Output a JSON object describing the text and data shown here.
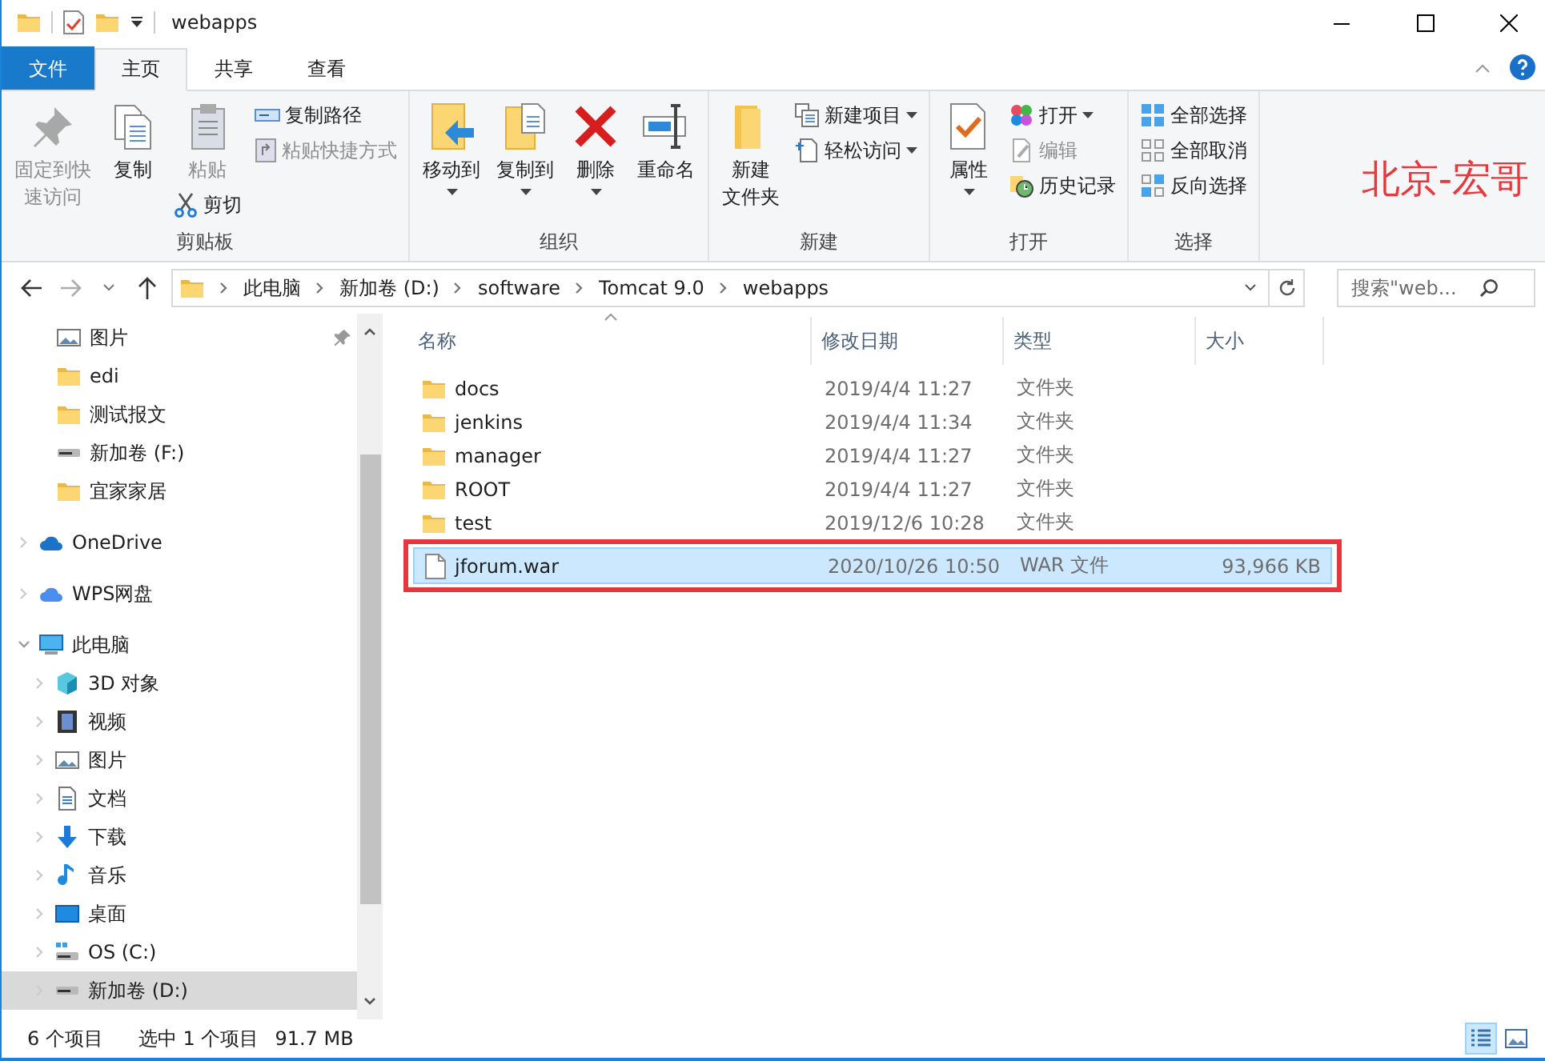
{
  "window": {
    "title": "webapps"
  },
  "tabs": [
    {
      "label": "文件",
      "kind": "file",
      "selected": false
    },
    {
      "label": "主页",
      "kind": "tab",
      "selected": true
    },
    {
      "label": "共享",
      "kind": "tab",
      "selected": false
    },
    {
      "label": "查看",
      "kind": "tab",
      "selected": false
    }
  ],
  "ribbon": {
    "groups": [
      {
        "label": "剪贴板",
        "columns": [
          [
            {
              "kind": "large",
              "lines": [
                "固定到快",
                "速访问"
              ],
              "disabled": true,
              "dropdown": false
            }
          ],
          [
            {
              "kind": "large",
              "lines": [
                "复制"
              ],
              "disabled": false,
              "dropdown": false
            }
          ],
          [
            {
              "kind": "large",
              "lines": [
                "粘贴"
              ],
              "disabled": true,
              "dropdown": false
            },
            {
              "kind": "small",
              "lines": [
                "剪切"
              ],
              "disabled": false,
              "dropdown": false
            }
          ],
          [
            {
              "kind": "small",
              "lines": [
                "复制路径"
              ],
              "disabled": false,
              "dropdown": false
            },
            {
              "kind": "small",
              "lines": [
                "粘贴快捷方式"
              ],
              "disabled": true,
              "dropdown": false
            }
          ]
        ]
      },
      {
        "label": "组织",
        "columns": [
          [
            {
              "kind": "large",
              "lines": [
                "移动到"
              ],
              "disabled": false,
              "dropdown": true
            }
          ],
          [
            {
              "kind": "large",
              "lines": [
                "复制到"
              ],
              "disabled": false,
              "dropdown": true
            }
          ],
          [
            {
              "kind": "large",
              "lines": [
                "删除"
              ],
              "disabled": false,
              "dropdown": true
            }
          ],
          [
            {
              "kind": "large",
              "lines": [
                "重命名"
              ],
              "disabled": false,
              "dropdown": false
            }
          ]
        ]
      },
      {
        "label": "新建",
        "columns": [
          [
            {
              "kind": "large",
              "lines": [
                "新建",
                "文件夹"
              ],
              "disabled": false,
              "dropdown": false
            }
          ],
          [
            {
              "kind": "small",
              "lines": [
                "新建项目"
              ],
              "disabled": false,
              "dropdown": true
            },
            {
              "kind": "small",
              "lines": [
                "轻松访问"
              ],
              "disabled": false,
              "dropdown": true
            }
          ]
        ]
      },
      {
        "label": "打开",
        "columns": [
          [
            {
              "kind": "large",
              "lines": [
                "属性"
              ],
              "disabled": false,
              "dropdown": true
            }
          ],
          [
            {
              "kind": "small",
              "lines": [
                "打开"
              ],
              "disabled": false,
              "dropdown": true
            },
            {
              "kind": "small",
              "lines": [
                "编辑"
              ],
              "disabled": true,
              "dropdown": false
            },
            {
              "kind": "small",
              "lines": [
                "历史记录"
              ],
              "disabled": false,
              "dropdown": false
            }
          ]
        ]
      },
      {
        "label": "选择",
        "columns": [
          [
            {
              "kind": "small",
              "lines": [
                "全部选择"
              ],
              "disabled": false,
              "dropdown": false
            },
            {
              "kind": "small",
              "lines": [
                "全部取消"
              ],
              "disabled": false,
              "dropdown": false
            },
            {
              "kind": "small",
              "lines": [
                "反向选择"
              ],
              "disabled": false,
              "dropdown": false
            }
          ]
        ]
      }
    ],
    "annotation": "北京-宏哥"
  },
  "address": {
    "crumbs": [
      "此电脑",
      "新加卷 (D:)",
      "software",
      "Tomcat 9.0",
      "webapps"
    ]
  },
  "search": {
    "placeholder": "搜索\"web..."
  },
  "nav": {
    "quick_access": [
      {
        "label": "图片",
        "kind": "pictures",
        "pinned": true
      },
      {
        "label": "edi",
        "kind": "folder",
        "pinned": false
      },
      {
        "label": "测试报文",
        "kind": "folder",
        "pinned": false
      },
      {
        "label": "新加卷 (F:)",
        "kind": "drive",
        "pinned": false
      },
      {
        "label": "宜家家居",
        "kind": "folder",
        "pinned": false
      }
    ],
    "roots": [
      {
        "label": "OneDrive",
        "kind": "cloud",
        "expanded": false
      },
      {
        "label": "WPS网盘",
        "kind": "wps",
        "expanded": false
      },
      {
        "label": "此电脑",
        "kind": "pc",
        "expanded": true,
        "children": [
          {
            "label": "3D 对象",
            "kind": "cube",
            "selected": false
          },
          {
            "label": "视频",
            "kind": "video",
            "selected": false
          },
          {
            "label": "图片",
            "kind": "pictures",
            "selected": false
          },
          {
            "label": "文档",
            "kind": "docs",
            "selected": false
          },
          {
            "label": "下载",
            "kind": "download",
            "selected": false
          },
          {
            "label": "音乐",
            "kind": "music",
            "selected": false
          },
          {
            "label": "桌面",
            "kind": "desktop",
            "selected": false
          },
          {
            "label": "OS (C:)",
            "kind": "osdrive",
            "selected": false
          },
          {
            "label": "新加卷 (D:)",
            "kind": "drive",
            "selected": true
          }
        ]
      }
    ]
  },
  "table": {
    "columns": [
      "名称",
      "修改日期",
      "类型",
      "大小"
    ],
    "rows": [
      {
        "name": "docs",
        "kind": "folder",
        "date": "2019/4/4 11:27",
        "type": "文件夹",
        "selected": false,
        "marked": false
      },
      {
        "name": "jenkins",
        "kind": "folder",
        "date": "2019/4/4 11:34",
        "type": "文件夹",
        "selected": false,
        "marked": false
      },
      {
        "name": "manager",
        "kind": "folder",
        "date": "2019/4/4 11:27",
        "type": "文件夹",
        "selected": false,
        "marked": false
      },
      {
        "name": "ROOT",
        "kind": "folder",
        "date": "2019/4/4 11:27",
        "type": "文件夹",
        "selected": false,
        "marked": false
      },
      {
        "name": "test",
        "kind": "folder",
        "date": "2019/12/6 10:28",
        "type": "文件夹",
        "selected": false,
        "marked": false
      },
      {
        "name": "jforum.war",
        "kind": "file",
        "date": "2020/10/26 10:50",
        "type": "WAR 文件",
        "size": "93,966 KB",
        "selected": true,
        "marked": true
      }
    ]
  },
  "status_bar": {
    "count": "6 个项目",
    "selection": "选中 1 个项目",
    "selection_size": "91.7 MB",
    "views": [
      {
        "kind": "details",
        "selected": true
      },
      {
        "kind": "large",
        "selected": false
      }
    ]
  }
}
